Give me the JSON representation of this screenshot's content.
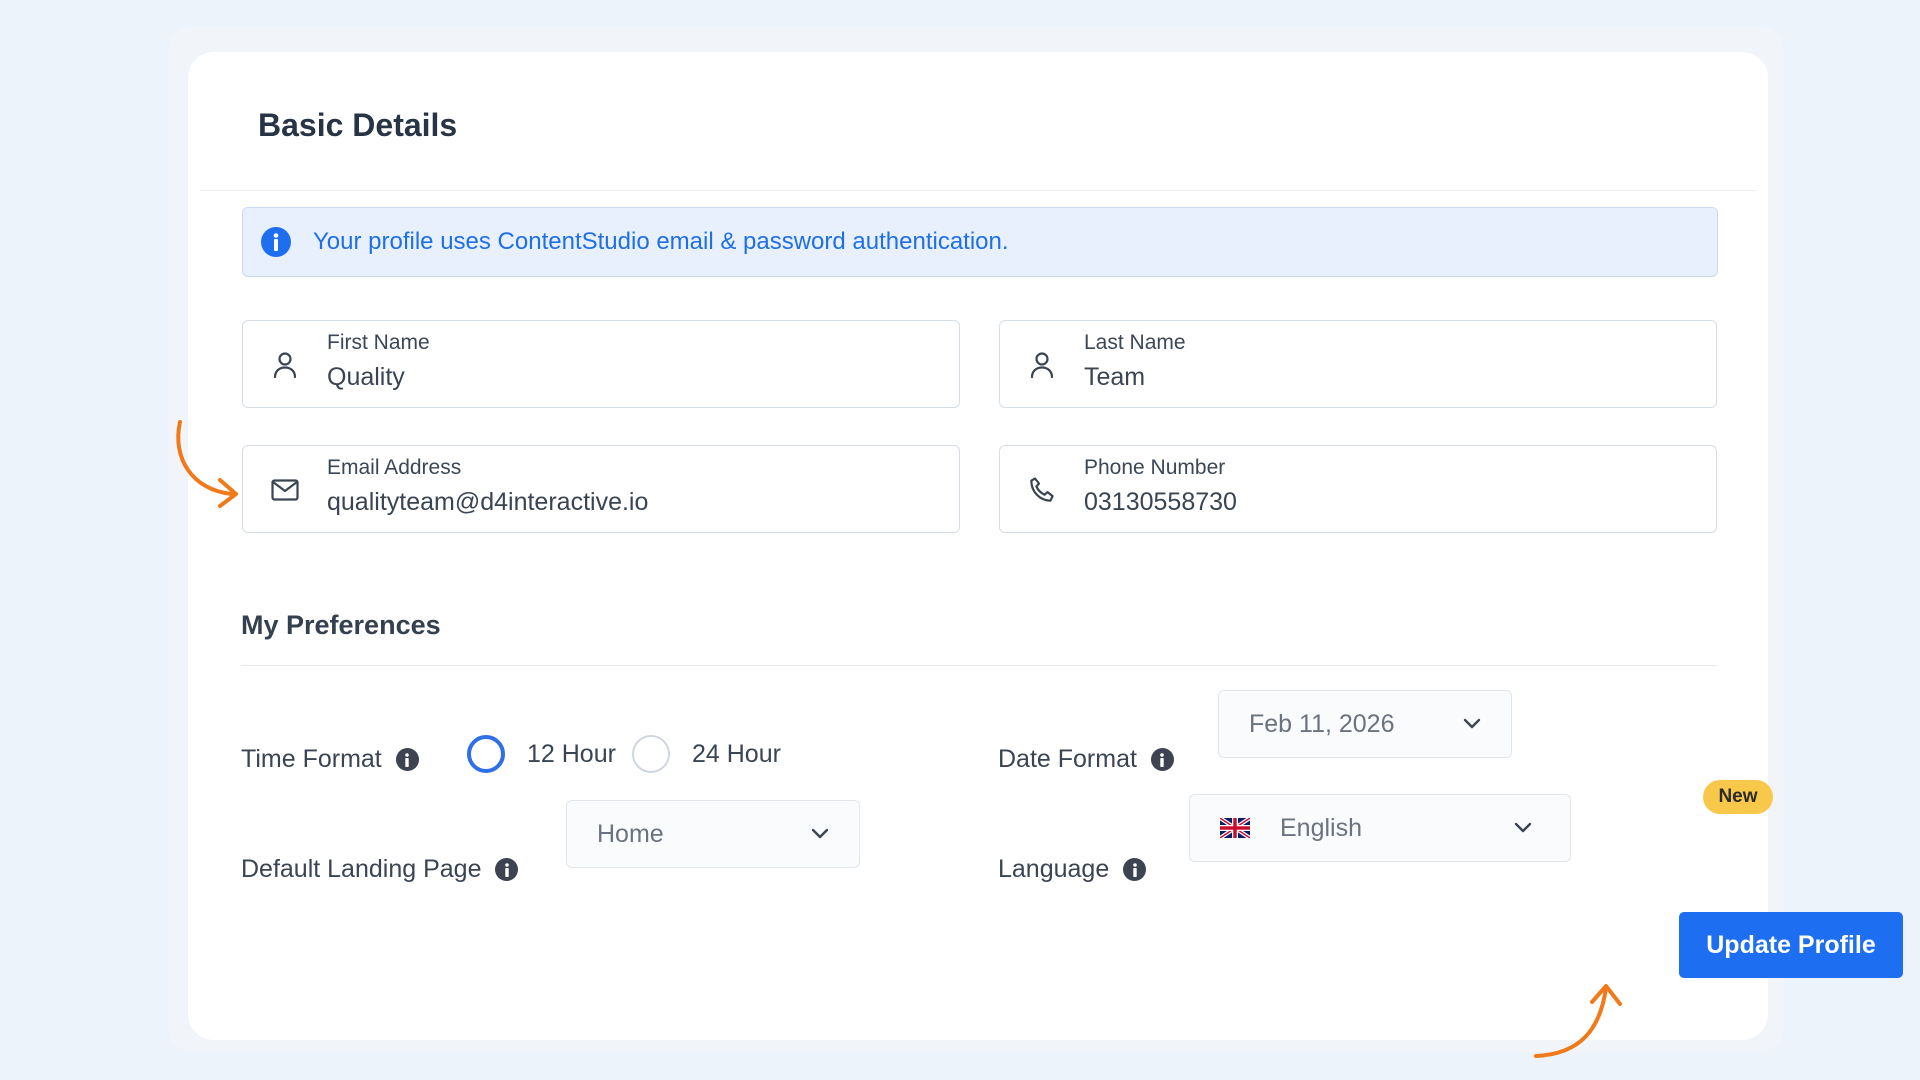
{
  "basic_details": {
    "title": "Basic Details",
    "info_banner": "Your profile uses ContentStudio email & password authentication.",
    "fields": {
      "first_name": {
        "label": "First Name",
        "value": "Quality",
        "icon": "user-icon"
      },
      "last_name": {
        "label": "Last Name",
        "value": "Team",
        "icon": "user-icon"
      },
      "email": {
        "label": "Email Address",
        "value": "qualityteam@d4interactive.io",
        "icon": "mail-icon"
      },
      "phone": {
        "label": "Phone Number",
        "value": "03130558730",
        "icon": "phone-icon"
      }
    }
  },
  "preferences": {
    "title": "My Preferences",
    "time_format": {
      "label": "Time Format",
      "options": [
        "12 Hour",
        "24 Hour"
      ],
      "selected": "12 Hour"
    },
    "date_format": {
      "label": "Date Format",
      "value": "Feb 11, 2026"
    },
    "default_landing_page": {
      "label": "Default Landing Page",
      "value": "Home"
    },
    "language": {
      "label": "Language",
      "value": "English",
      "flag": "uk-flag-icon",
      "badge": "New"
    }
  },
  "actions": {
    "update_label": "Update Profile"
  },
  "colors": {
    "accent": "#1e6ef2",
    "info_text": "#1f6fe6",
    "info_bg": "#e8f0fe",
    "badge": "#f8c84b",
    "annotation_arrow": "#f07a1a"
  }
}
